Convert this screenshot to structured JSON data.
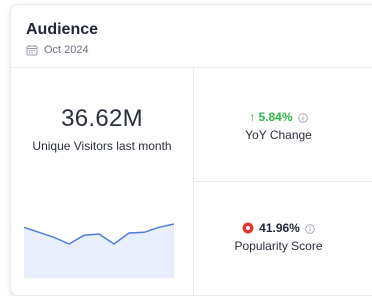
{
  "widget": {
    "title": "Audience",
    "date": "Oct 2024"
  },
  "visitors": {
    "value": "36.62M",
    "label": "Unique Visitors last month"
  },
  "yoy": {
    "arrow": "↑",
    "value": "5.84%",
    "label": "YoY Change"
  },
  "popularity": {
    "value": "41.96%",
    "label": "Popularity Score"
  },
  "colors": {
    "positive": "#2fb84a",
    "sparkline": "#4f7de0",
    "sparkline_fill": "#e8eefb",
    "popularity_badge": "#e53935"
  },
  "sparkline": {
    "values": [
      10,
      8.5,
      7,
      5,
      7.6,
      8,
      5,
      8.3,
      8.5,
      10,
      11
    ]
  }
}
